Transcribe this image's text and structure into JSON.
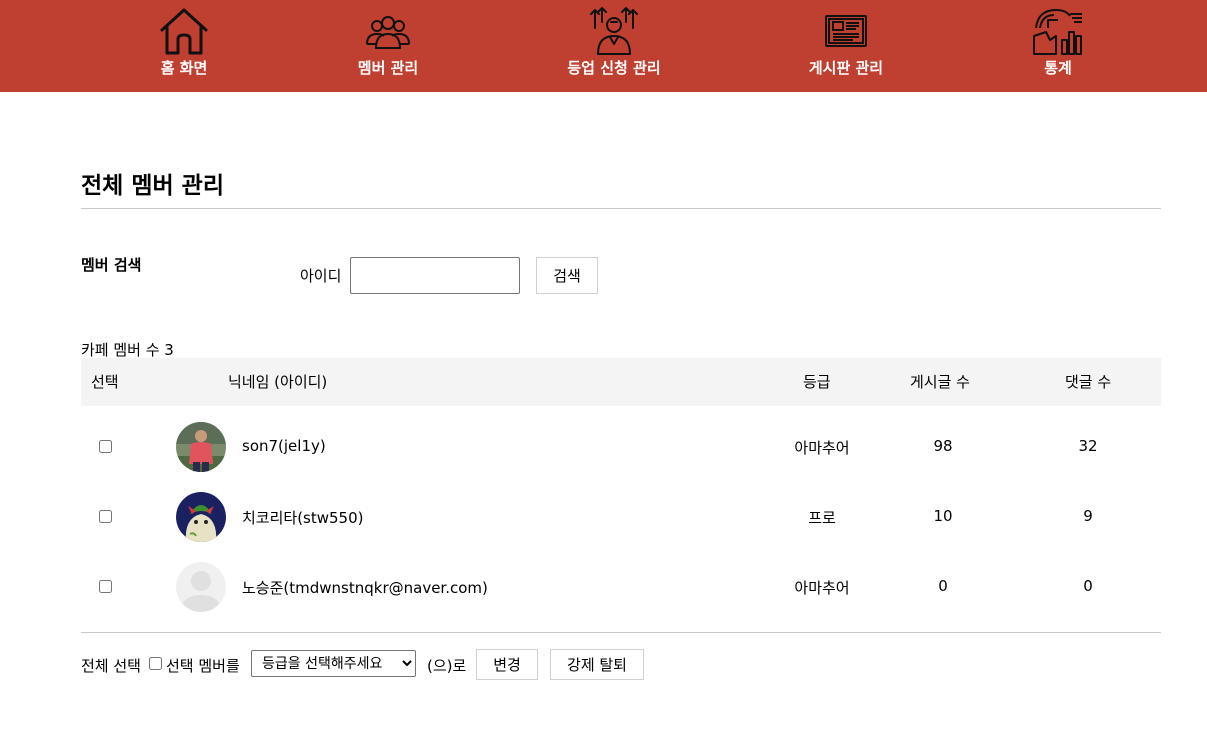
{
  "nav": {
    "items": [
      {
        "label": "홈 화면",
        "icon": "home-icon"
      },
      {
        "label": "멤버 관리",
        "icon": "people-group-icon"
      },
      {
        "label": "등업 신청 관리",
        "icon": "user-upgrade-icon"
      },
      {
        "label": "게시판 관리",
        "icon": "board-icon"
      },
      {
        "label": "통계",
        "icon": "statistics-icon"
      }
    ],
    "background": "#bf3f31"
  },
  "page": {
    "title": "전체 멤버 관리"
  },
  "search": {
    "heading": "멤버 검색",
    "field_label": "아이디",
    "input_value": "",
    "button_label": "검색"
  },
  "members": {
    "count_label": "카페 멤버 수 3",
    "columns": {
      "select": "선택",
      "name": "닉네임 (아이디)",
      "grade": "등급",
      "posts": "게시글 수",
      "comments": "댓글 수"
    },
    "rows": [
      {
        "name": "son7(jel1y)",
        "grade": "아마추어",
        "posts": "98",
        "comments": "32",
        "avatar": "soccer-player-photo",
        "checked": false
      },
      {
        "name": "치코리타(stw550)",
        "grade": "프로",
        "posts": "10",
        "comments": "9",
        "avatar": "chikorita-character",
        "checked": false
      },
      {
        "name": "노승준(tmdwnstnqkr@naver.com)",
        "grade": "아마추어",
        "posts": "0",
        "comments": "0",
        "avatar": "default-user-silhouette",
        "checked": false
      }
    ]
  },
  "footer": {
    "select_all_label": "전체 선택",
    "selected_members_label": "선택 멤버를",
    "grade_select_value": "등급을 선택해주세요",
    "suffix_label": "(으)로",
    "change_button": "변경",
    "kick_button": "강제 탈퇴"
  }
}
